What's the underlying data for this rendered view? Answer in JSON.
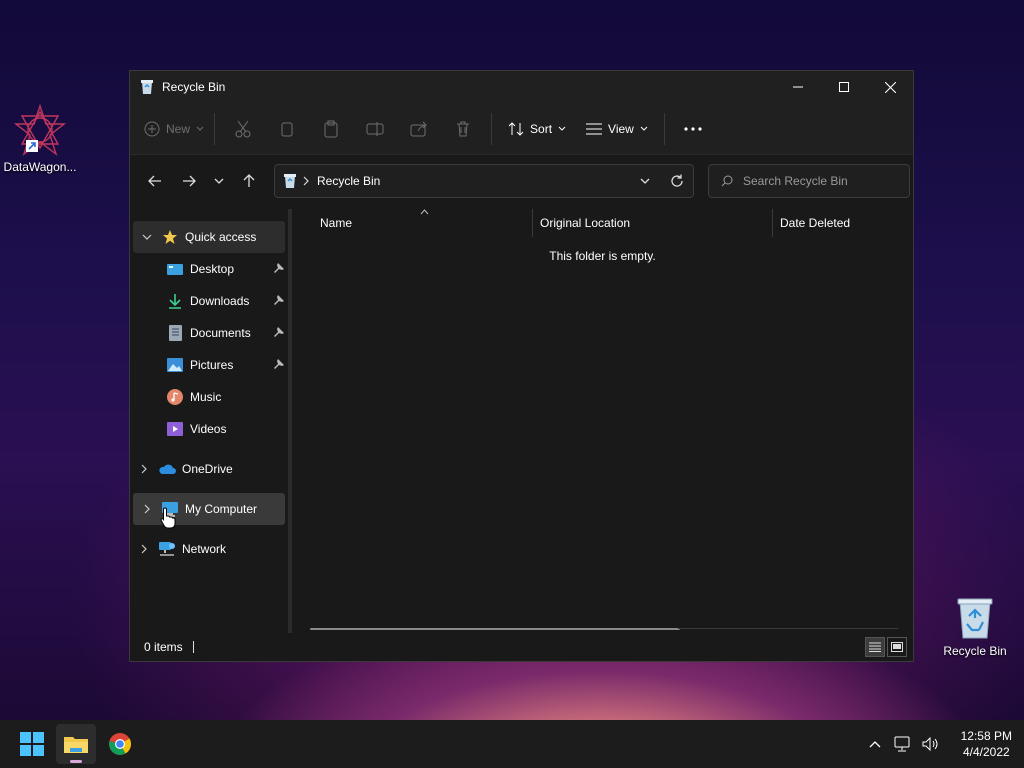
{
  "desktop": {
    "icons": [
      {
        "label": "DataWagon..."
      },
      {
        "label": "Recycle Bin"
      }
    ]
  },
  "window": {
    "title": "Recycle Bin",
    "toolbar": {
      "new_label": "New",
      "sort_label": "Sort",
      "view_label": "View"
    },
    "address": {
      "path": "Recycle Bin"
    },
    "search": {
      "placeholder": "Search Recycle Bin"
    },
    "nav": {
      "quick_access": "Quick access",
      "items": [
        {
          "label": "Desktop",
          "icon": "desktop-icon"
        },
        {
          "label": "Downloads",
          "icon": "download-icon"
        },
        {
          "label": "Documents",
          "icon": "documents-icon"
        },
        {
          "label": "Pictures",
          "icon": "pictures-icon"
        },
        {
          "label": "Music",
          "icon": "music-icon"
        },
        {
          "label": "Videos",
          "icon": "videos-icon"
        }
      ],
      "onedrive": "OneDrive",
      "my_computer": "My Computer",
      "network": "Network"
    },
    "columns": [
      "Name",
      "Original Location",
      "Date Deleted"
    ],
    "empty_message": "This folder is empty.",
    "status": "0 items"
  },
  "taskbar": {
    "time": "12:58 PM",
    "date": "4/4/2022"
  },
  "colors": {
    "accent": "#4cc2ff",
    "folder": "#f2c94c"
  }
}
